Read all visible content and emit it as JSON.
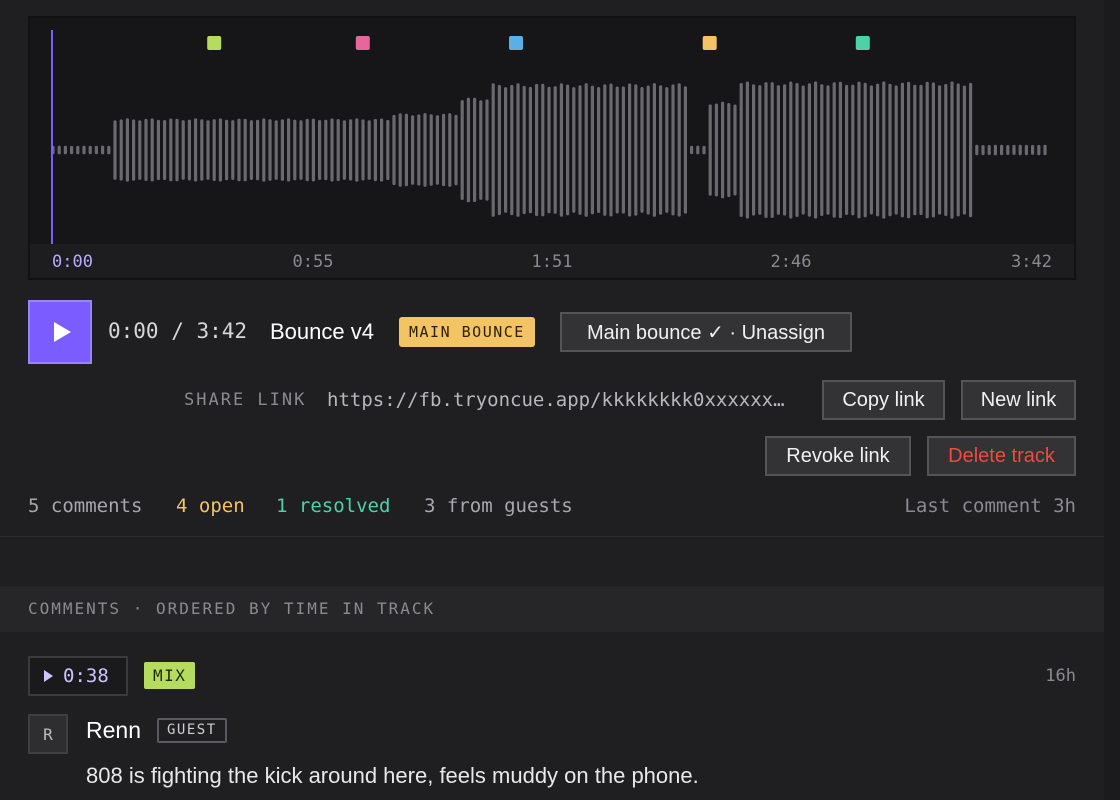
{
  "waveform": {
    "duration_seconds": 222,
    "playhead_seconds": 0,
    "time_ticks": [
      "0:00",
      "0:55",
      "1:51",
      "2:46",
      "3:42"
    ],
    "markers": [
      {
        "time_seconds": 36,
        "color": "#b5dc5e"
      },
      {
        "time_seconds": 69,
        "color": "#e8669c"
      },
      {
        "time_seconds": 103,
        "color": "#5ab0e6"
      },
      {
        "time_seconds": 146,
        "color": "#f2c464"
      },
      {
        "time_seconds": 180,
        "color": "#4fd1a8"
      }
    ],
    "bar_color": "#6a6a6e",
    "playhead_color": "#7a5cff",
    "amplitude_segments": [
      {
        "from_seconds": 0,
        "to_seconds": 13,
        "amplitude": 0.05
      },
      {
        "from_seconds": 13,
        "to_seconds": 75,
        "amplitude": 0.36
      },
      {
        "from_seconds": 75,
        "to_seconds": 90,
        "amplitude": 0.42
      },
      {
        "from_seconds": 90,
        "to_seconds": 97,
        "amplitude": 0.6
      },
      {
        "from_seconds": 97,
        "to_seconds": 141,
        "amplitude": 0.76
      },
      {
        "from_seconds": 141,
        "to_seconds": 146,
        "amplitude": 0.05
      },
      {
        "from_seconds": 146,
        "to_seconds": 153,
        "amplitude": 0.55
      },
      {
        "from_seconds": 153,
        "to_seconds": 204,
        "amplitude": 0.78
      },
      {
        "from_seconds": 204,
        "to_seconds": 222,
        "amplitude": 0.06
      }
    ]
  },
  "player": {
    "current_time": "0:00",
    "duration": "3:42",
    "timecode": "0:00 / 3:42",
    "track_title": "Bounce v4",
    "main_badge": "MAIN BOUNCE",
    "assign_button": "Main bounce ✓ · Unassign"
  },
  "share": {
    "label": "SHARE LINK",
    "url": "https://fb.tryoncue.app/kkkkkkkk0xxxxxx…",
    "copy_label": "Copy link",
    "new_label": "New link",
    "revoke_label": "Revoke link",
    "delete_label": "Delete track"
  },
  "stats": {
    "comments": "5 comments",
    "open": "4 open",
    "resolved": "1 resolved",
    "guests": "3 from guests",
    "last_comment": "Last comment 3h"
  },
  "colors": {
    "open": "#f2c464",
    "resolved": "#4fd1a8",
    "accent": "#7a5cff",
    "danger": "#f04a3d"
  },
  "comments_section": {
    "header": "COMMENTS · ORDERED BY TIME IN TRACK",
    "items": [
      {
        "time": "0:38",
        "tag": "MIX",
        "age": "16h",
        "avatar_initial": "R",
        "author": "Renn",
        "role_badge": "GUEST",
        "text": "808 is fighting the kick around here, feels muddy on the phone."
      }
    ]
  }
}
